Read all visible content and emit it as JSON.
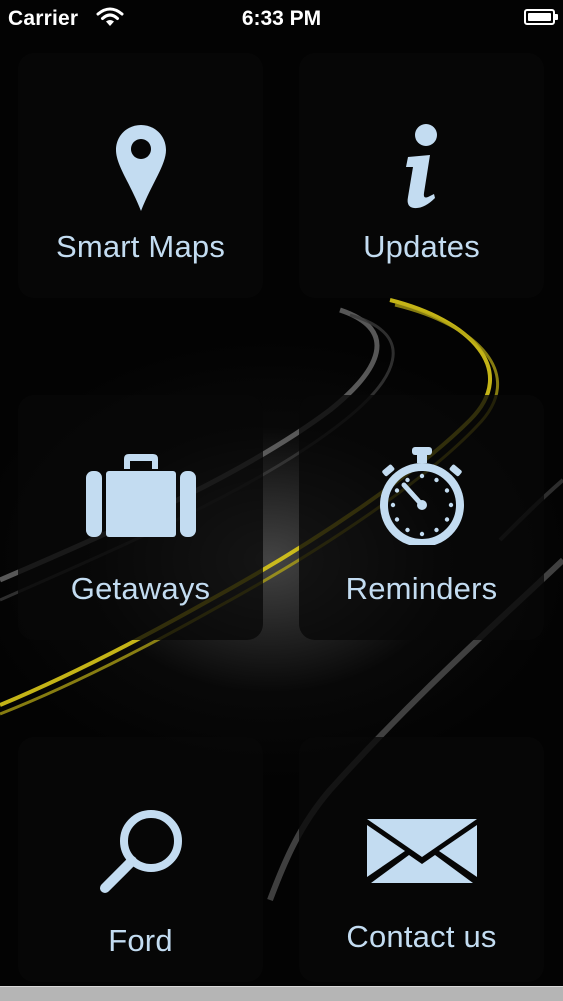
{
  "status_bar": {
    "carrier": "Carrier",
    "time": "6:33 PM",
    "icons": [
      "wifi-icon",
      "battery-icon"
    ]
  },
  "tiles": [
    {
      "label": "Smart Maps",
      "icon": "map-pin-icon"
    },
    {
      "label": "Updates",
      "icon": "info-icon"
    },
    {
      "label": "Getaways",
      "icon": "suitcase-icon"
    },
    {
      "label": "Reminders",
      "icon": "stopwatch-icon"
    },
    {
      "label": "Ford",
      "icon": "search-icon"
    },
    {
      "label": "Contact us",
      "icon": "envelope-icon"
    }
  ],
  "colors": {
    "icon_and_text": "#c3dcf1",
    "tile_background": "#080808",
    "road_line": "#d9c81a"
  }
}
